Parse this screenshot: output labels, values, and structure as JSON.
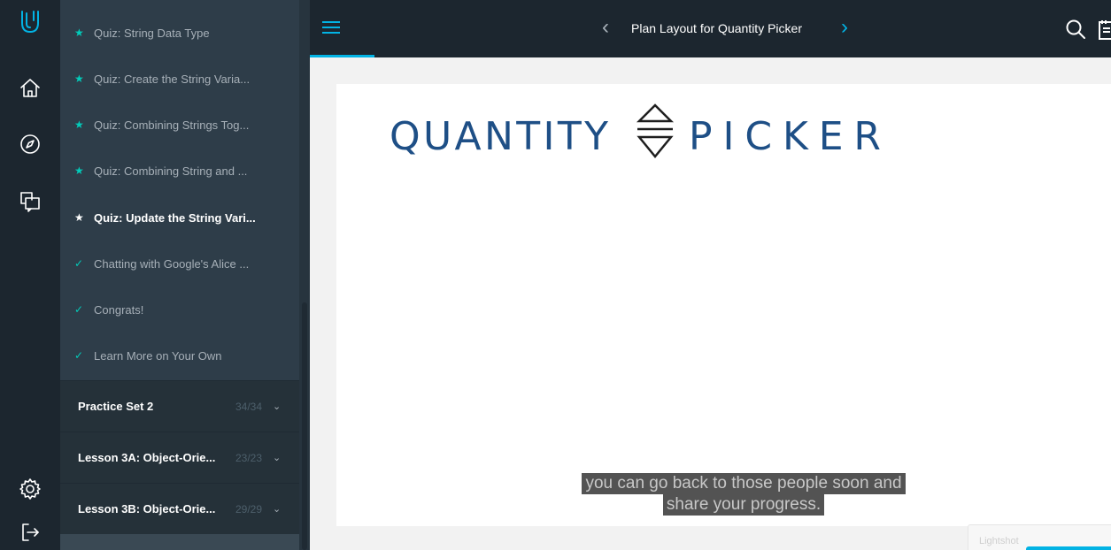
{
  "rail": {
    "icons": [
      "udacity-logo-icon",
      "home-icon",
      "compass-icon",
      "chat-icon",
      "gear-icon",
      "logout-icon"
    ]
  },
  "sidebar": {
    "concepts": [
      {
        "label": "Quiz: String Data Type",
        "mark": "★",
        "status": "quiz"
      },
      {
        "label": "Quiz: Create the String Varia...",
        "mark": "★",
        "status": "quiz"
      },
      {
        "label": "Quiz: Combining Strings Tog...",
        "mark": "★",
        "status": "quiz"
      },
      {
        "label": "Quiz: Combining String and ...",
        "mark": "★",
        "status": "quiz"
      },
      {
        "label": "Quiz: Update the String Vari...",
        "mark": "★",
        "status": "active"
      },
      {
        "label": "Chatting with Google's Alice ...",
        "mark": "✓",
        "status": "done"
      },
      {
        "label": "Congrats!",
        "mark": "✓",
        "status": "done"
      },
      {
        "label": "Learn More on Your Own",
        "mark": "✓",
        "status": "done"
      }
    ],
    "lessons": [
      {
        "name": "Practice Set 2",
        "count": "34/34"
      },
      {
        "name": "Lesson 3A: Object-Orie...",
        "count": "23/23"
      },
      {
        "name": "Lesson 3B: Object-Orie...",
        "count": "29/29"
      }
    ]
  },
  "topbar": {
    "title": "Plan Layout for Quantity Picker",
    "prev": "‹",
    "next": "›"
  },
  "video": {
    "whiteboard_text": "QUANTITY ⇕ PICKER",
    "captions": [
      "you can go back to those people soon and",
      "share your progress."
    ]
  },
  "lightshot": {
    "label": "Lightshot"
  },
  "colors": {
    "accent": "#02b3e4",
    "check": "#02ccba",
    "rail": "#1c262f",
    "sidebar": "#2e3d49"
  }
}
